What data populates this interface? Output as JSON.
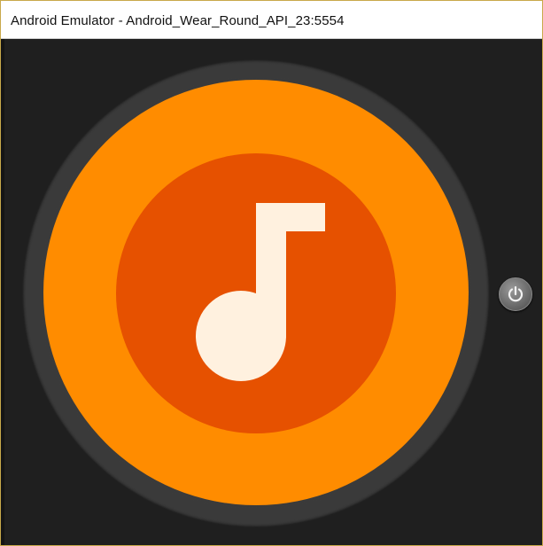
{
  "window": {
    "title": "Android Emulator - Android_Wear_Round_API_23:5554"
  },
  "screen": {
    "app_icon": "music-note-icon",
    "colors": {
      "bezel": "#3a3a3a",
      "outer_face": "#ff8c00",
      "inner_disc": "#e65100",
      "note": "#fff1df"
    }
  },
  "side_controls": {
    "power_icon": "power-icon"
  }
}
